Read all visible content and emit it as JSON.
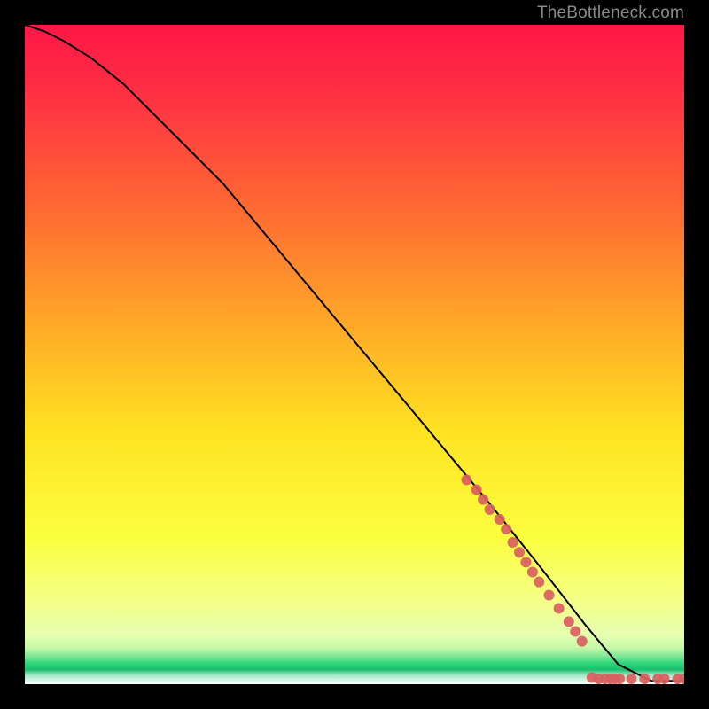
{
  "attribution": "TheBottleneck.com",
  "chart_data": {
    "type": "line",
    "title": "",
    "xlabel": "",
    "ylabel": "",
    "xlim": [
      0,
      100
    ],
    "ylim": [
      0,
      100
    ],
    "grid": false,
    "legend": false,
    "background_gradient": {
      "top": "#ff1a48",
      "mid_upper": "#ff7a2a",
      "mid": "#ffe622",
      "mid_lower": "#f5ff66",
      "band_green": "#2dd97a",
      "bottom": "#ffffff"
    },
    "series": [
      {
        "name": "curve",
        "color": "#000000",
        "type": "line",
        "x": [
          0,
          3,
          6,
          10,
          15,
          20,
          30,
          40,
          50,
          60,
          70,
          78,
          85,
          90,
          95,
          100
        ],
        "y": [
          100,
          99,
          97.5,
          95,
          91,
          86,
          76,
          64,
          52,
          40,
          28,
          18,
          9,
          3,
          0.5,
          0.5
        ]
      },
      {
        "name": "markers-slope",
        "color": "#d96060",
        "type": "scatter",
        "x": [
          67,
          68.5,
          69.5,
          70.5,
          72,
          73,
          74,
          75,
          76,
          77,
          78,
          79.5,
          81,
          82.5,
          83.5,
          84.5
        ],
        "y": [
          31,
          29.5,
          28,
          26.5,
          25,
          23.5,
          21.5,
          20,
          18.5,
          17,
          15.5,
          13.5,
          11.5,
          9.5,
          8,
          6.5
        ]
      },
      {
        "name": "markers-flat",
        "color": "#d96060",
        "type": "scatter",
        "x": [
          86,
          87,
          88,
          88.8,
          89.5,
          90.2,
          92,
          94,
          96,
          97,
          99,
          100
        ],
        "y": [
          1,
          0.8,
          0.8,
          0.8,
          0.8,
          0.8,
          0.8,
          0.8,
          0.8,
          0.8,
          0.8,
          0.8
        ]
      }
    ]
  }
}
